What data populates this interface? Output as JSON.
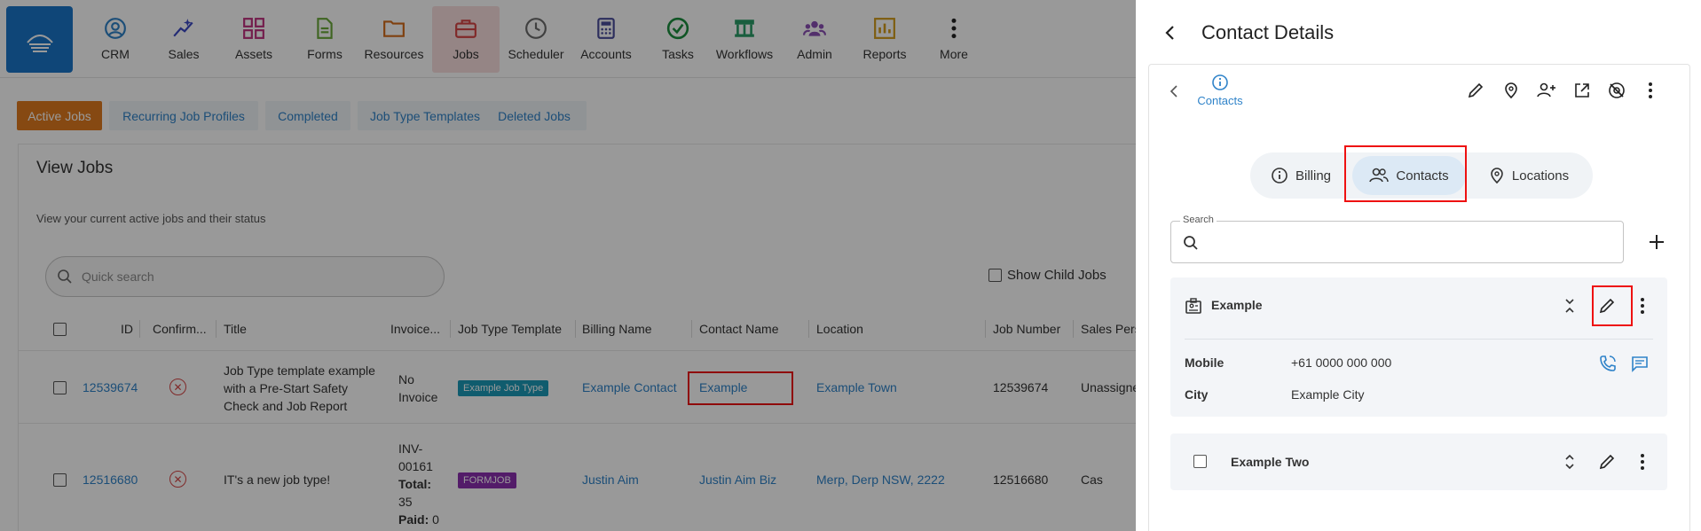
{
  "nav": {
    "items": [
      {
        "label": "CRM",
        "icon": "person-circle-icon",
        "color": "#2f83c9"
      },
      {
        "label": "Sales",
        "icon": "sparkle-chart-icon",
        "color": "#3b48c4"
      },
      {
        "label": "Assets",
        "icon": "grid-icon",
        "color": "#c0317f"
      },
      {
        "label": "Forms",
        "icon": "document-icon",
        "color": "#6aa83a"
      },
      {
        "label": "Resources",
        "icon": "folder-icon",
        "color": "#d46b1a"
      },
      {
        "label": "Jobs",
        "icon": "briefcase-icon",
        "color": "#d64545"
      },
      {
        "label": "Scheduler",
        "icon": "clock-icon",
        "color": "#6c6c6c"
      },
      {
        "label": "Accounts",
        "icon": "calculator-icon",
        "color": "#4a4e9c"
      },
      {
        "label": "Tasks",
        "icon": "check-circle-icon",
        "color": "#1b8e3e"
      },
      {
        "label": "Workflows",
        "icon": "workflow-icon",
        "color": "#2a9d68"
      },
      {
        "label": "Admin",
        "icon": "group-icon",
        "color": "#8a4fb5"
      },
      {
        "label": "Reports",
        "icon": "bar-chart-icon",
        "color": "#d39b1a"
      },
      {
        "label": "More",
        "icon": "more-vertical-icon",
        "color": "#222"
      }
    ]
  },
  "tabs": [
    "Active Jobs",
    "Recurring Job Profiles",
    "Completed",
    "Job Type Templates",
    "Deleted Jobs"
  ],
  "view": {
    "title": "View Jobs",
    "description": "View your current active jobs and their status",
    "search_placeholder": "Quick search",
    "show_child_jobs": "Show Child Jobs"
  },
  "table": {
    "headers": [
      "ID",
      "Confirm...",
      "Title",
      "Invoice...",
      "Job Type Template",
      "Billing Name",
      "Contact Name",
      "Location",
      "Job Number",
      "Sales Pers"
    ],
    "rows": [
      {
        "id": "12539674",
        "title": [
          "Job Type template example",
          "with a Pre-Start Safety",
          "Check and Job Report"
        ],
        "invoice": [
          "No",
          "Invoice"
        ],
        "template": "Example Job Type",
        "template_color": "#1b9ab7",
        "billing": "Example Contact",
        "contact": "Example",
        "location": "Example Town",
        "job_number": "12539674",
        "sales": "Unassigne"
      },
      {
        "id": "12516680",
        "title": [
          "IT's a new job type!"
        ],
        "invoice": [
          "INV-",
          "00161"
        ],
        "invoice_total_label": "Total:",
        "invoice_total": "35",
        "invoice_paid_label": "Paid:",
        "invoice_paid": "0",
        "template": "FORMJOB",
        "template_color": "#8a2fb0",
        "billing": "Justin Aim",
        "contact": "Justin Aim Biz",
        "location": "Merp, Derp NSW, 2222",
        "job_number": "12516680",
        "sales": "Cas"
      }
    ]
  },
  "panel": {
    "title": "Contact Details",
    "breadcrumb": "Contacts",
    "segments": [
      "Billing",
      "Contacts",
      "Locations"
    ],
    "search_label": "Search",
    "contacts": [
      {
        "name": "Example",
        "mobile_label": "Mobile",
        "mobile": "+61 0000 000 000",
        "city_label": "City",
        "city": "Example City"
      },
      {
        "name": "Example Two"
      }
    ]
  },
  "colors": {
    "accent": "#2f83c9",
    "active_tab": "#e07a1f",
    "highlight": "#ee1111"
  }
}
